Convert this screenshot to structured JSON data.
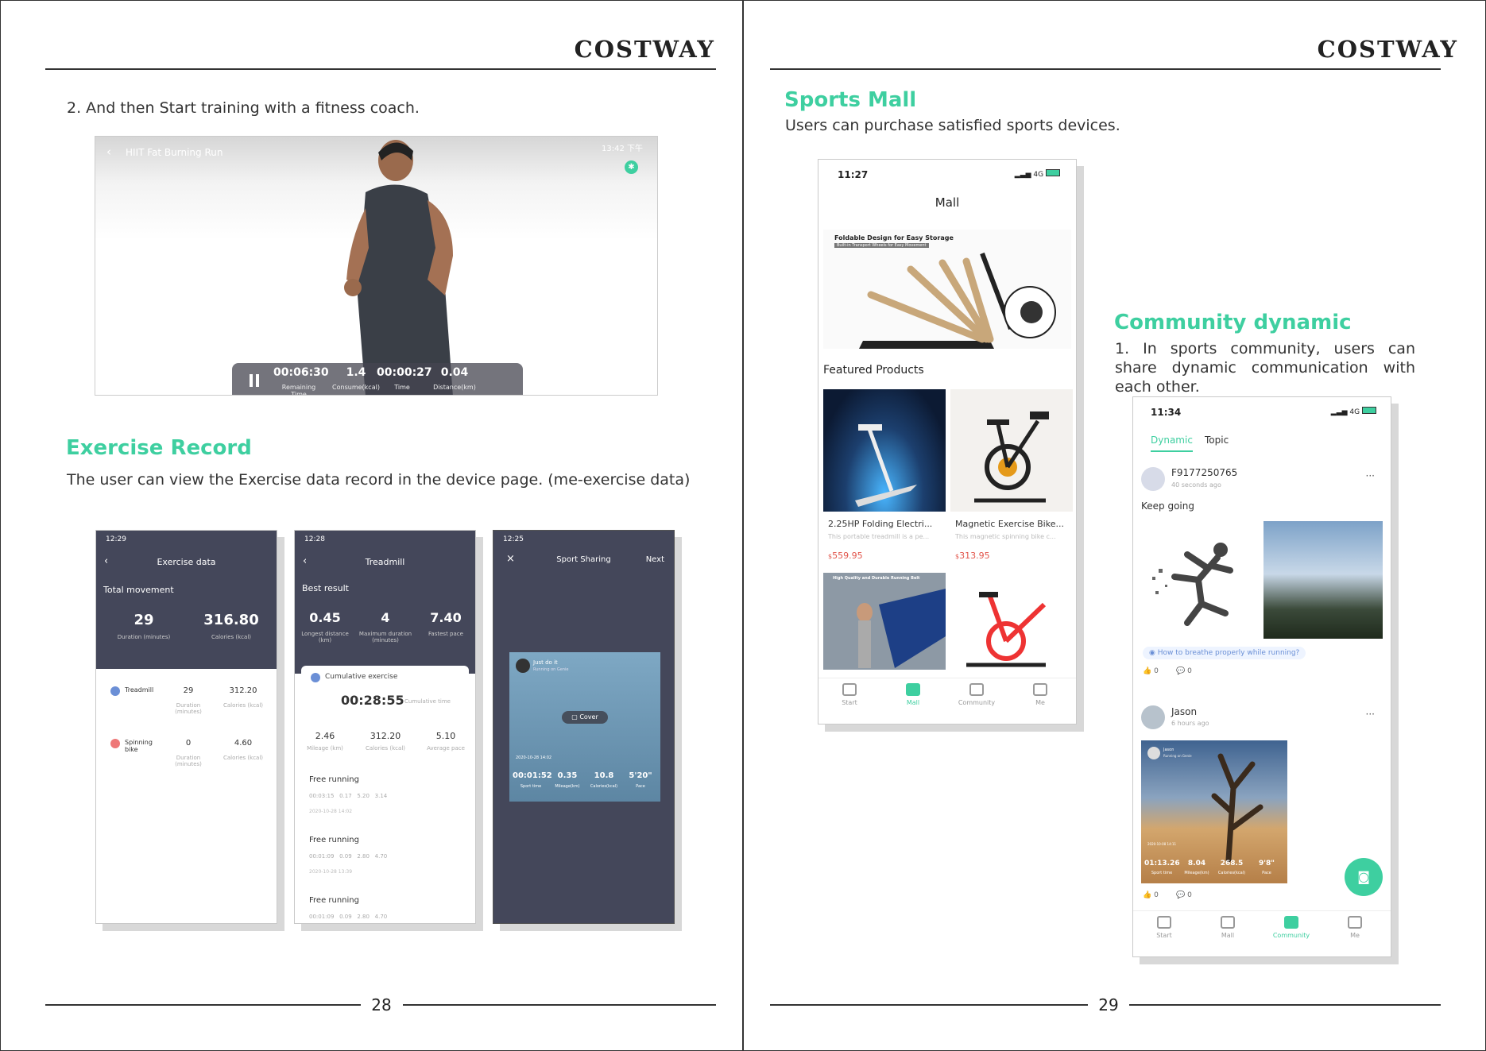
{
  "brand": "COSTWAY",
  "page_left": {
    "number": "28",
    "step": "2.  And then Start training with a fitness coach.",
    "video": {
      "title": "HIIT Fat Burning Run",
      "clock": "13:42 下午",
      "stats": [
        {
          "value": "00:06:30",
          "label": "Remaining Time"
        },
        {
          "value": "1.4",
          "label": "Consume(kcal)"
        },
        {
          "value": "00:00:27",
          "label": "Time"
        },
        {
          "value": "0.04",
          "label": "Distance(km)"
        }
      ]
    },
    "section_title": "Exercise Record",
    "section_text": "The user can view the Exercise data record in the device page. (me-exercise data)",
    "screen1": {
      "time": "12:29",
      "title": "Exercise data",
      "total_label": "Total movement",
      "duration": "29",
      "duration_label": "Duration (minutes)",
      "calories": "316.80",
      "calories_label": "Calories (kcal)",
      "rows": [
        {
          "name": "Treadmill",
          "duration": "29",
          "calories": "312.20"
        },
        {
          "name": "Spinning bike",
          "duration": "0",
          "calories": "4.60"
        }
      ],
      "row_dur_label": "Duration (minutes)",
      "row_cal_label": "Calories (kcal)"
    },
    "screen2": {
      "time": "12:28",
      "title": "Treadmill",
      "best": "Best result",
      "b1": "0.45",
      "b1l": "Longest distance (km)",
      "b2": "4",
      "b2l": "Maximum duration (minutes)",
      "b3": "7.40",
      "b3l": "Fastest pace",
      "cum": "Cumulative exercise",
      "cum_time": "00:28:55",
      "cum_time_label": "Cumulative time",
      "m1": "2.46",
      "m1l": "Mileage (km)",
      "m2": "312.20",
      "m2l": "Calories (kcal)",
      "m3": "5.10",
      "m3l": "Average pace",
      "runs": [
        {
          "label": "Free running",
          "stats": "00:03:15   0.17   5.20   3.14",
          "date": "2020-10-28 14:02"
        },
        {
          "label": "Free running",
          "stats": "00:01:09   0.09   2.80   4.70",
          "date": "2020-10-28 13:39"
        },
        {
          "label": "Free running",
          "stats": "00:01:09   0.09   2.80   4.70",
          "date": ""
        }
      ]
    },
    "screen3": {
      "time": "12:25",
      "title": "Sport Sharing",
      "close": "×",
      "next": "Next",
      "user": "Just do it",
      "sub": "Running on Genie",
      "cover": "Cover",
      "date": "2020-10-28 14:02",
      "stats": [
        {
          "value": "00:01:52",
          "label": "Sport time"
        },
        {
          "value": "0.35",
          "label": "Mileage(km)"
        },
        {
          "value": "10.8",
          "label": "Calories(kcal)"
        },
        {
          "value": "5'20\"",
          "label": "Pace"
        }
      ]
    }
  },
  "page_right": {
    "number": "29",
    "mall_title": "Sports Mall",
    "mall_text": "Users can purchase satisfied sports devices.",
    "mall": {
      "time": "11:27",
      "network": "4G",
      "title": "Mall",
      "banner_title": "Foldable Design for Easy Storage",
      "banner_sub": "Built-in Transport Wheels for Easy Movement",
      "featured": "Featured Products",
      "products": [
        {
          "name": "2.25HP Folding Electri...",
          "desc": "This portable treadmill is a pe...",
          "price": "559.95"
        },
        {
          "name": "Magnetic Exercise Bike...",
          "desc": "This magnetic spinning bike c...",
          "price": "313.95"
        }
      ],
      "banner3": "High Quality and Durable Running Belt",
      "currency": "$",
      "tabs": [
        "Start",
        "Mall",
        "Community",
        "Me"
      ]
    },
    "comm_title": "Community dynamic",
    "comm_text": "1. In sports community, users can share dynamic communication with each other.",
    "community": {
      "time": "11:34",
      "network": "4G",
      "tab1": "Dynamic",
      "tab2": "Topic",
      "post1": {
        "user": "F9177250765",
        "ago": "40 seconds ago",
        "text": "Keep going",
        "topic": "How to breathe properly while running?",
        "likes": "0",
        "comments": "0"
      },
      "post2": {
        "user": "Jason",
        "ago": "6 hours ago",
        "likes": "0",
        "comments": "0",
        "card_user": "Jason",
        "card_sub": "Running on Genie",
        "card_date": "2020-10-08 14:11",
        "stats": [
          {
            "value": "01:13.26",
            "label": "Sport time"
          },
          {
            "value": "8.04",
            "label": "Mileage(km)"
          },
          {
            "value": "268.5",
            "label": "Calories(kcal)"
          },
          {
            "value": "9'8\"",
            "label": "Pace"
          }
        ]
      },
      "more": "···",
      "tabs": [
        "Start",
        "Mall",
        "Community",
        "Me"
      ]
    }
  }
}
